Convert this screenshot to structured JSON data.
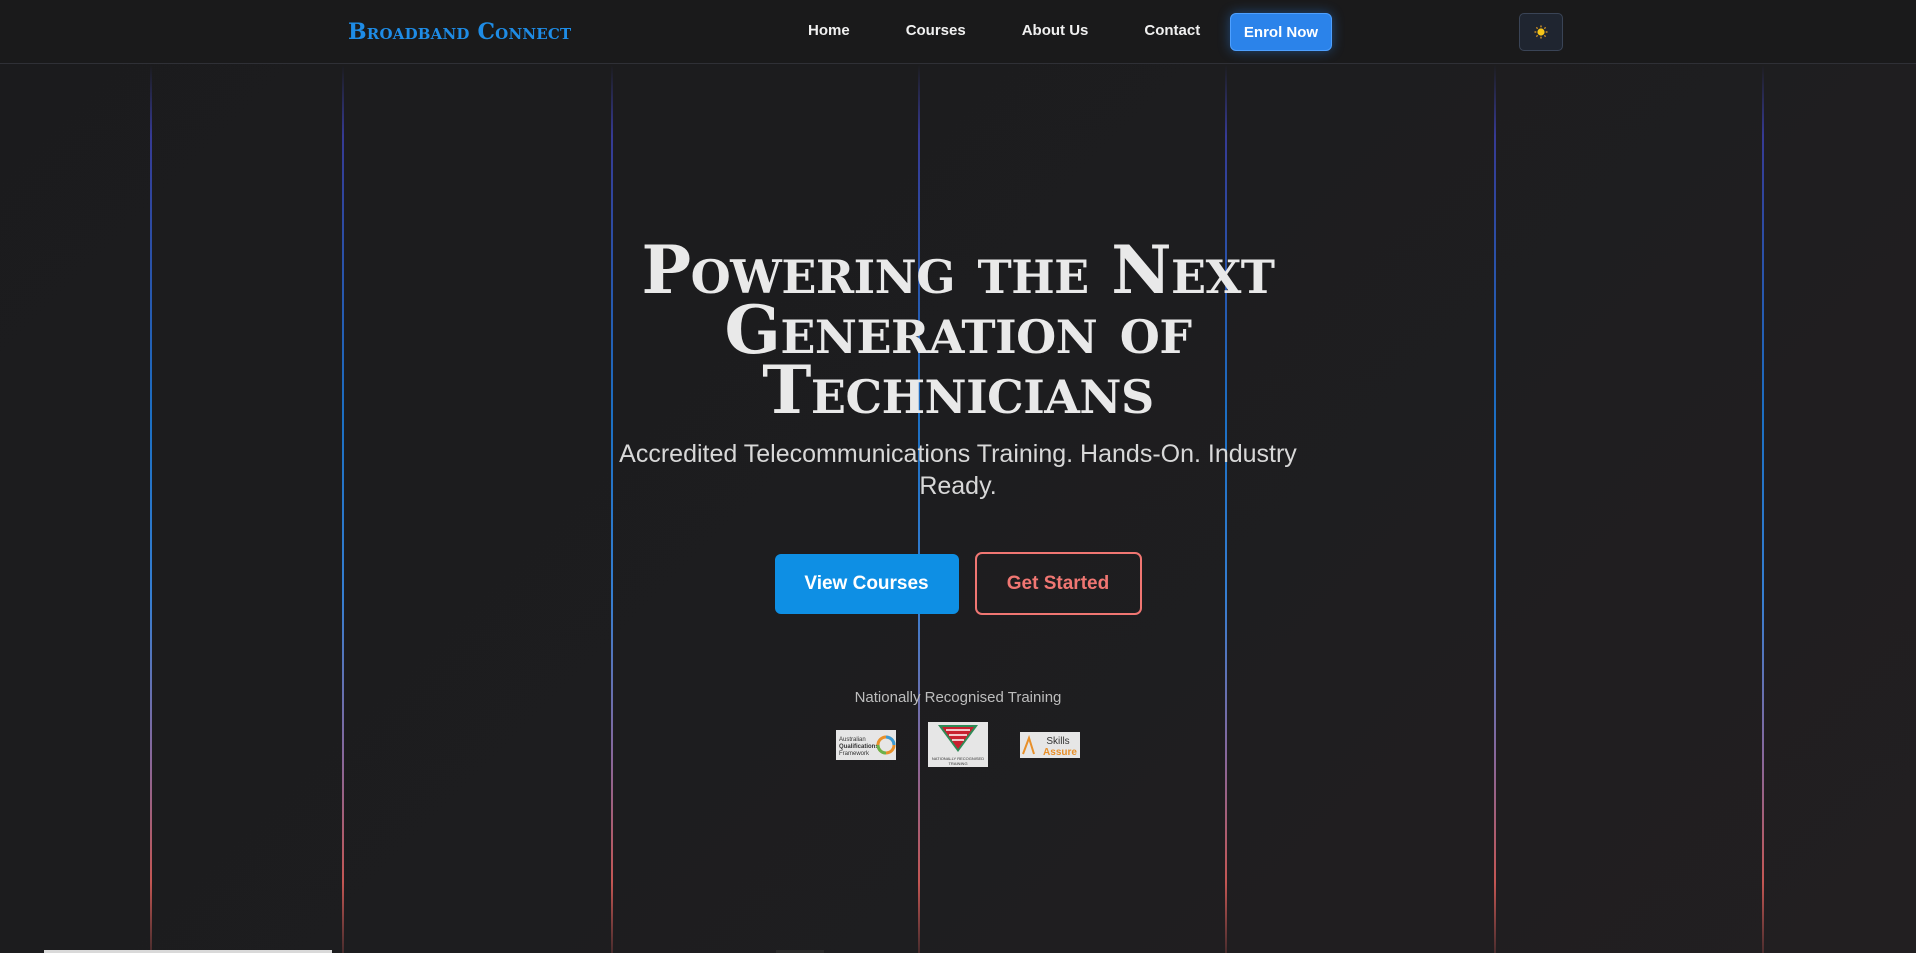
{
  "nav": {
    "brand": "Broadband Connect",
    "links": [
      {
        "label": "Home"
      },
      {
        "label": "Courses"
      },
      {
        "label": "About Us"
      },
      {
        "label": "Contact"
      }
    ],
    "cta": "Enrol Now",
    "theme_icon": "sun-icon"
  },
  "hero": {
    "title": "Powering the Next Generation of Technicians",
    "subtitle": "Accredited Telecommunications Training. Hands-On. Industry Ready.",
    "primary_button": "View Courses",
    "secondary_button": "Get Started"
  },
  "recognition": {
    "label": "Nationally Recognised Training",
    "logos": [
      {
        "name": "aqf-logo",
        "text": "Australian Qualifications Framework"
      },
      {
        "name": "nrt-logo",
        "text": "Nationally Recognised Training"
      },
      {
        "name": "skills-assure-logo",
        "text": "Skills Assure"
      }
    ]
  },
  "colors": {
    "brand": "#1e8ce6",
    "primary": "#0e8fe4",
    "accent": "#f07672",
    "enrol": "#2b83ea"
  }
}
